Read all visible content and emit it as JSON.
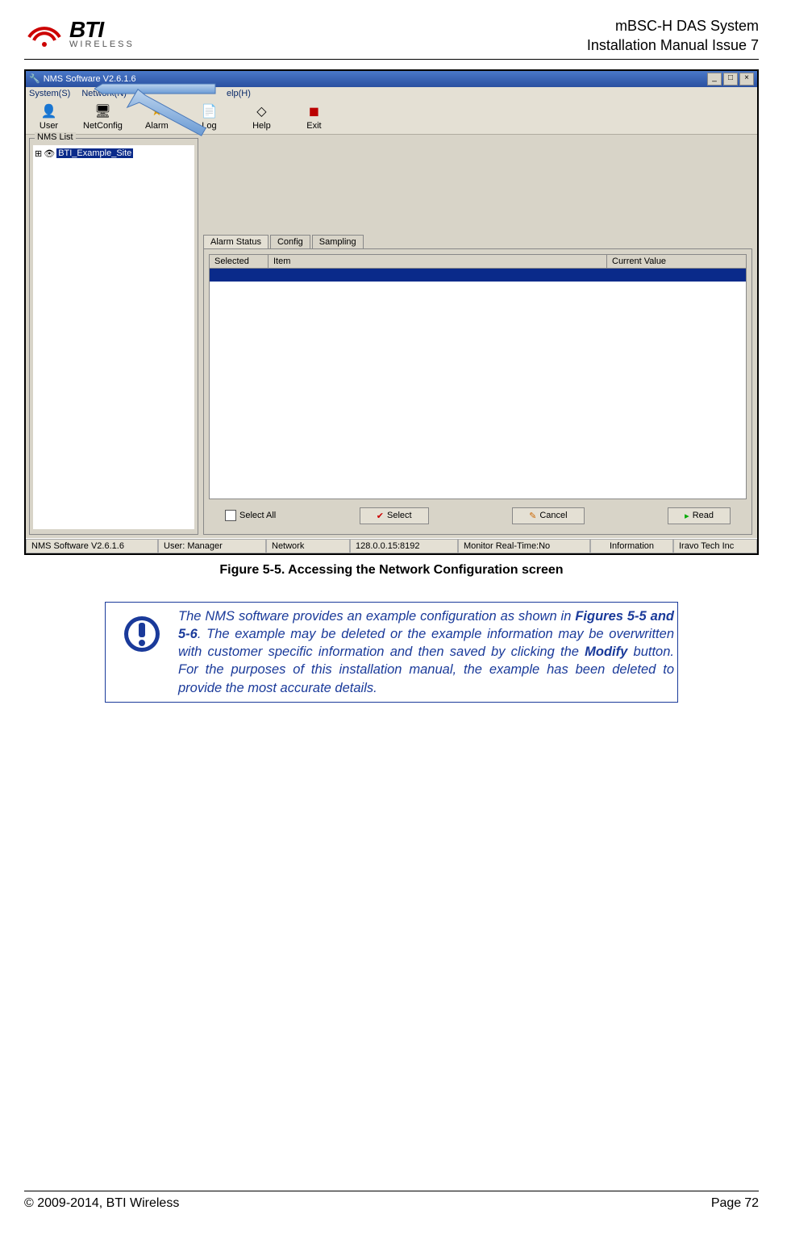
{
  "header": {
    "logo_main": "BTI",
    "logo_sub": "WIRELESS",
    "system": "mBSC-H DAS System",
    "manual": "Installation Manual Issue 7"
  },
  "app": {
    "title": "NMS Software V2.6.1.6",
    "menubar": [
      "System(S)",
      "Network(N)",
      "",
      "elp(H)"
    ],
    "toolbar": [
      {
        "label": "User",
        "icon": "👤"
      },
      {
        "label": "NetConfig",
        "icon": "🖥"
      },
      {
        "label": "Alarm",
        "icon": "⭐"
      },
      {
        "label": "Log",
        "icon": "📄"
      },
      {
        "label": "Help",
        "icon": "◇"
      },
      {
        "label": "Exit",
        "icon": "🔲"
      }
    ],
    "nms_list_label": "NMS List",
    "tree_item": "BTI_Example_Site",
    "tabs": [
      "Alarm Status",
      "Config",
      "Sampling"
    ],
    "table_headers": {
      "col1": "Selected",
      "col2": "Item",
      "col3": "Current Value"
    },
    "select_all": "Select All",
    "buttons": {
      "select": "Select",
      "cancel": "Cancel",
      "read": "Read"
    },
    "statusbar": {
      "app": "NMS Software V2.6.1.6",
      "user": "User: Manager",
      "network": "Network",
      "ip": "128.0.0.15:8192",
      "monitor": "Monitor Real-Time:No",
      "info": "Information",
      "company": "Iravo Tech Inc"
    }
  },
  "caption": "Figure 5-5. Accessing the Network Configuration screen",
  "note": {
    "part1": "The NMS software provides an example configuration as shown in ",
    "fig_ref": "Figures 5-5 and 5-6",
    "part2": ". The example may be deleted or the example information may be overwritten with customer specific information and then saved by clicking the ",
    "modify": "Modify",
    "part3": " button. For the purposes of this installation manual, the example has been deleted to provide the most accurate details."
  },
  "footer": {
    "copyright": "© 2009-2014, BTI Wireless",
    "page_label": "Page",
    "page_num": "72"
  }
}
